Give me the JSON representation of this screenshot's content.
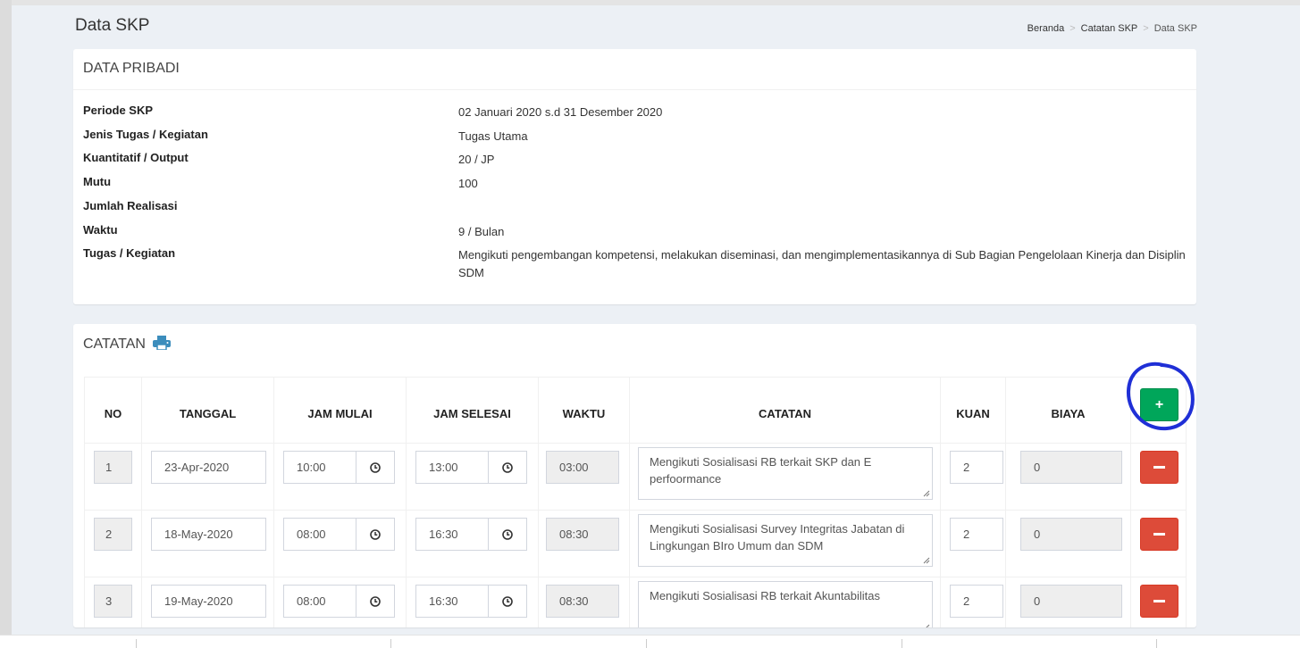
{
  "page": {
    "title": "Data SKP",
    "breadcrumb": [
      "Beranda",
      "Catatan SKP",
      "Data SKP"
    ],
    "breadcrumb_separator": ">"
  },
  "personal": {
    "header": "DATA PRIBADI",
    "rows": [
      {
        "label": "Periode SKP",
        "value": "02 Januari 2020 s.d 31 Desember 2020"
      },
      {
        "label": "Jenis Tugas / Kegiatan",
        "value": "Tugas Utama"
      },
      {
        "label": "Kuantitatif / Output",
        "value": "20 / JP"
      },
      {
        "label": "Mutu",
        "value": "100"
      },
      {
        "label": "Jumlah Realisasi",
        "value": ""
      },
      {
        "label": "Waktu",
        "value": "9 / Bulan"
      },
      {
        "label": "Tugas / Kegiatan",
        "value": "Mengikuti pengembangan kompetensi, melakukan diseminasi, dan mengimplementasikannya di Sub Bagian Pengelolaan Kinerja dan Disiplin SDM"
      }
    ]
  },
  "notes": {
    "header": "CATATAN",
    "print_icon": "print-icon",
    "columns": [
      "NO",
      "TANGGAL",
      "JAM MULAI",
      "JAM SELESAI",
      "WAKTU",
      "CATATAN",
      "KUAN",
      "BIAYA"
    ],
    "add_button_symbol": "+",
    "rows": [
      {
        "no": "1",
        "tanggal": "23-Apr-2020",
        "jam_mulai": "10:00",
        "jam_selesai": "13:00",
        "waktu": "03:00",
        "catatan": "Mengikuti Sosialisasi RB terkait SKP dan E perfoormance",
        "kuan": "2",
        "biaya": "0"
      },
      {
        "no": "2",
        "tanggal": "18-May-2020",
        "jam_mulai": "08:00",
        "jam_selesai": "16:30",
        "waktu": "08:30",
        "catatan": "Mengikuti Sosialisasi Survey Integritas Jabatan di Lingkungan BIro Umum dan SDM",
        "kuan": "2",
        "biaya": "0"
      },
      {
        "no": "3",
        "tanggal": "19-May-2020",
        "jam_mulai": "08:00",
        "jam_selesai": "16:30",
        "waktu": "08:30",
        "catatan": "Mengikuti Sosialisasi RB terkait Akuntabilitas",
        "kuan": "2",
        "biaya": "0"
      }
    ]
  },
  "colors": {
    "background": "#ecf0f5",
    "add_button": "#00a65a",
    "delete_button": "#dd4b39",
    "print_icon": "#3c8dbc",
    "annotation_circle": "#1f2fd6"
  }
}
